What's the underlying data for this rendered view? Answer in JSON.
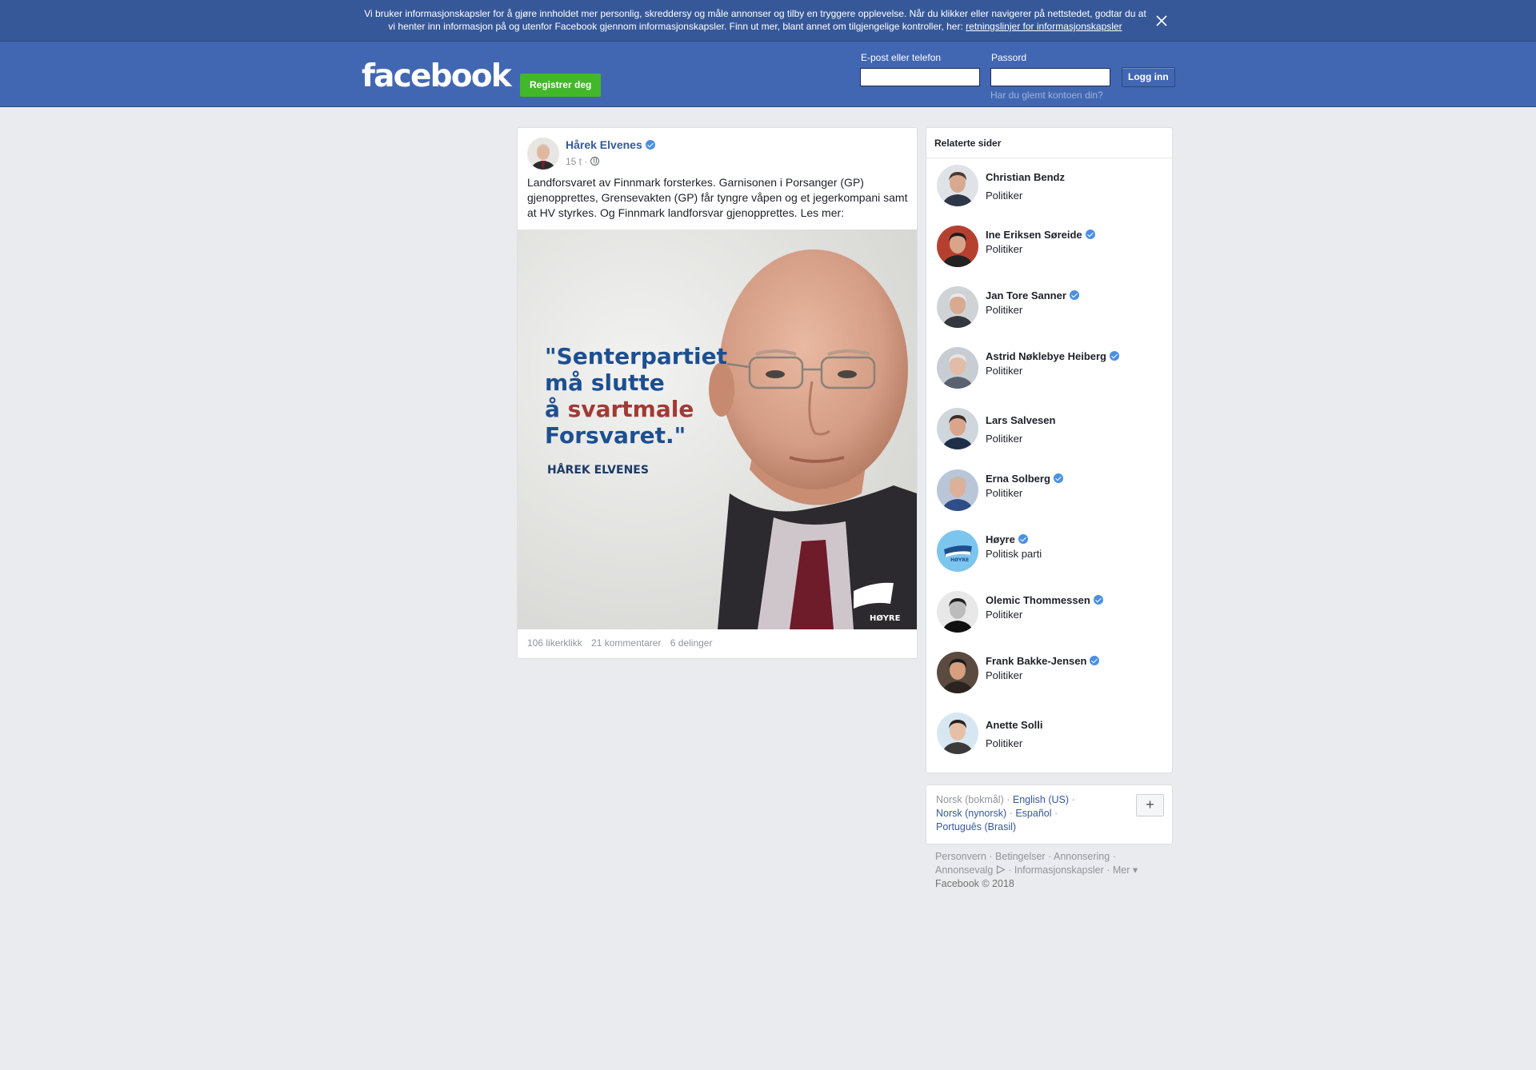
{
  "cookie_banner": {
    "text": "Vi bruker informasjonskapsler for å gjøre innholdet mer personlig, skreddersy og måle annonser og tilby en tryggere opplevelse. Når du klikker eller navigerer på nettstedet, godtar du at vi henter inn informasjon på og utenfor Facebook gjennom informasjonskapsler. Finn ut mer, blant annet om tilgjengelige kontroller, her: ",
    "link_text": "retningslinjer for informasjonskapsler",
    "close_icon": "close-icon"
  },
  "header": {
    "logo": "facebook",
    "register_label": "Registrer deg",
    "email_label": "E-post eller telefon",
    "email_value": "",
    "password_label": "Passord",
    "password_value": "",
    "login_label": "Logg inn",
    "forgot_label": "Har du glemt kontoen din?"
  },
  "post": {
    "author": "Hårek Elvenes",
    "time": "15 t ·",
    "text": "Landforsvaret av Finnmark forsterkes. Garnisonen i Porsanger (GP) gjenopprettes, Grensevakten (GP) får tyngre våpen og et jegerkompani samt at HV styrkes. Og Finnmark landforsvar gjenopprettes. Les mer:",
    "image": {
      "quote_line1": "\"Senterpartiet",
      "quote_line2": "må slutte",
      "quote_line3_a": "å ",
      "quote_line3_b": "svartmale",
      "quote_line4": "Forsvaret.\"",
      "attribution": "HÅREK ELVENES",
      "logo_text": "HØYRE"
    },
    "stats": {
      "likes": "106 likerklikk",
      "comments": "21 kommentarer",
      "shares": "6 delinger"
    }
  },
  "related": {
    "title": "Relaterte sider",
    "items": [
      {
        "name": "Christian Bendz",
        "category": "Politiker",
        "verified": false
      },
      {
        "name": "Ine Eriksen Søreide",
        "category": "Politiker",
        "verified": true
      },
      {
        "name": "Jan Tore Sanner",
        "category": "Politiker",
        "verified": true
      },
      {
        "name": "Astrid Nøklebye Heiberg",
        "category": "Politiker",
        "verified": true
      },
      {
        "name": "Lars Salvesen",
        "category": "Politiker",
        "verified": false
      },
      {
        "name": "Erna Solberg",
        "category": "Politiker",
        "verified": true
      },
      {
        "name": "Høyre",
        "category": "Politisk parti",
        "verified": true
      },
      {
        "name": "Olemic Thommessen",
        "category": "Politiker",
        "verified": true
      },
      {
        "name": "Frank Bakke-Jensen",
        "category": "Politiker",
        "verified": true
      },
      {
        "name": "Anette Solli",
        "category": "Politiker",
        "verified": false
      }
    ]
  },
  "languages": {
    "current": "Norsk (bokmål)",
    "options": [
      "English (US)",
      "Norsk (nynorsk)",
      "Español",
      "Português (Brasil)"
    ],
    "plus_label": "+"
  },
  "footer": {
    "links": [
      "Personvern",
      "Betingelser",
      "Annonsering",
      "Annonsevalg",
      "Informasjonskapsler",
      "Mer"
    ],
    "more_arrow": "▾",
    "copyright": "Facebook © 2018"
  },
  "colors": {
    "header_blue": "#4267b2",
    "banner_blue": "#365899",
    "register_green": "#42b72a",
    "quote_blue": "#1d4f91",
    "quote_red": "#a13a35"
  }
}
